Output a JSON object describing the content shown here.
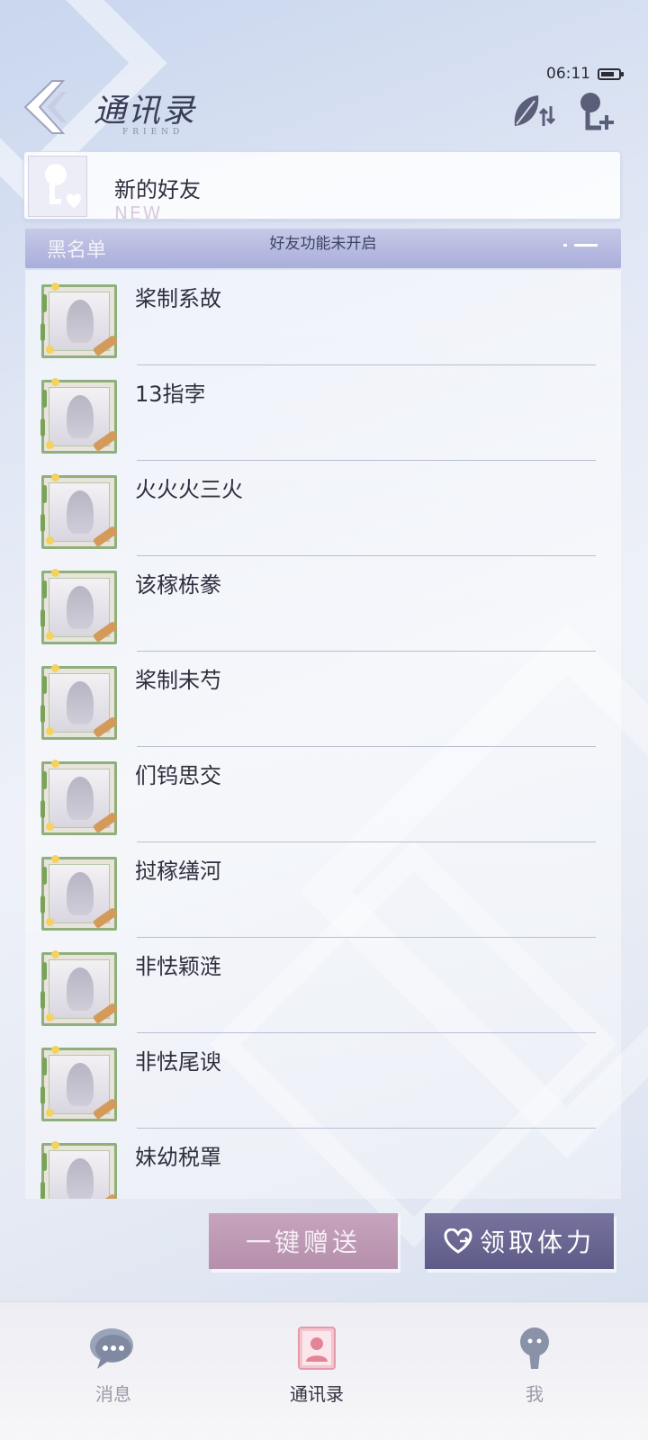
{
  "status_bar": {
    "time": "06:11"
  },
  "header": {
    "title": "通讯录",
    "subtitle": "FRIEND"
  },
  "new_friend": {
    "label": "新的好友",
    "ghost_text": "NEW"
  },
  "blacklist": {
    "label": "黑名单",
    "notice": "好友功能未开启"
  },
  "friends": [
    {
      "name": "桨制系故"
    },
    {
      "name": "13指孛"
    },
    {
      "name": "火火火三火"
    },
    {
      "name": "该稼栋豢"
    },
    {
      "name": "桨制未芍"
    },
    {
      "name": "们钨思交"
    },
    {
      "name": "挝稼缮河"
    },
    {
      "name": "非怯颖涟"
    },
    {
      "name": "非怯尾谀"
    },
    {
      "name": "妹幼税罩"
    }
  ],
  "actions": {
    "send_all": "一键赠送",
    "claim_stamina": "领取体力"
  },
  "tabs": [
    {
      "label": "消息",
      "icon": "chat-bubble-icon"
    },
    {
      "label": "通讯录",
      "icon": "contacts-book-icon"
    },
    {
      "label": "我",
      "icon": "profile-icon"
    }
  ],
  "colors": {
    "accent_purple": "#5f5b88",
    "accent_pink": "#b58fab",
    "blacklist_bar": "#a9aedb",
    "avatar_frame": "#8fb07a"
  }
}
